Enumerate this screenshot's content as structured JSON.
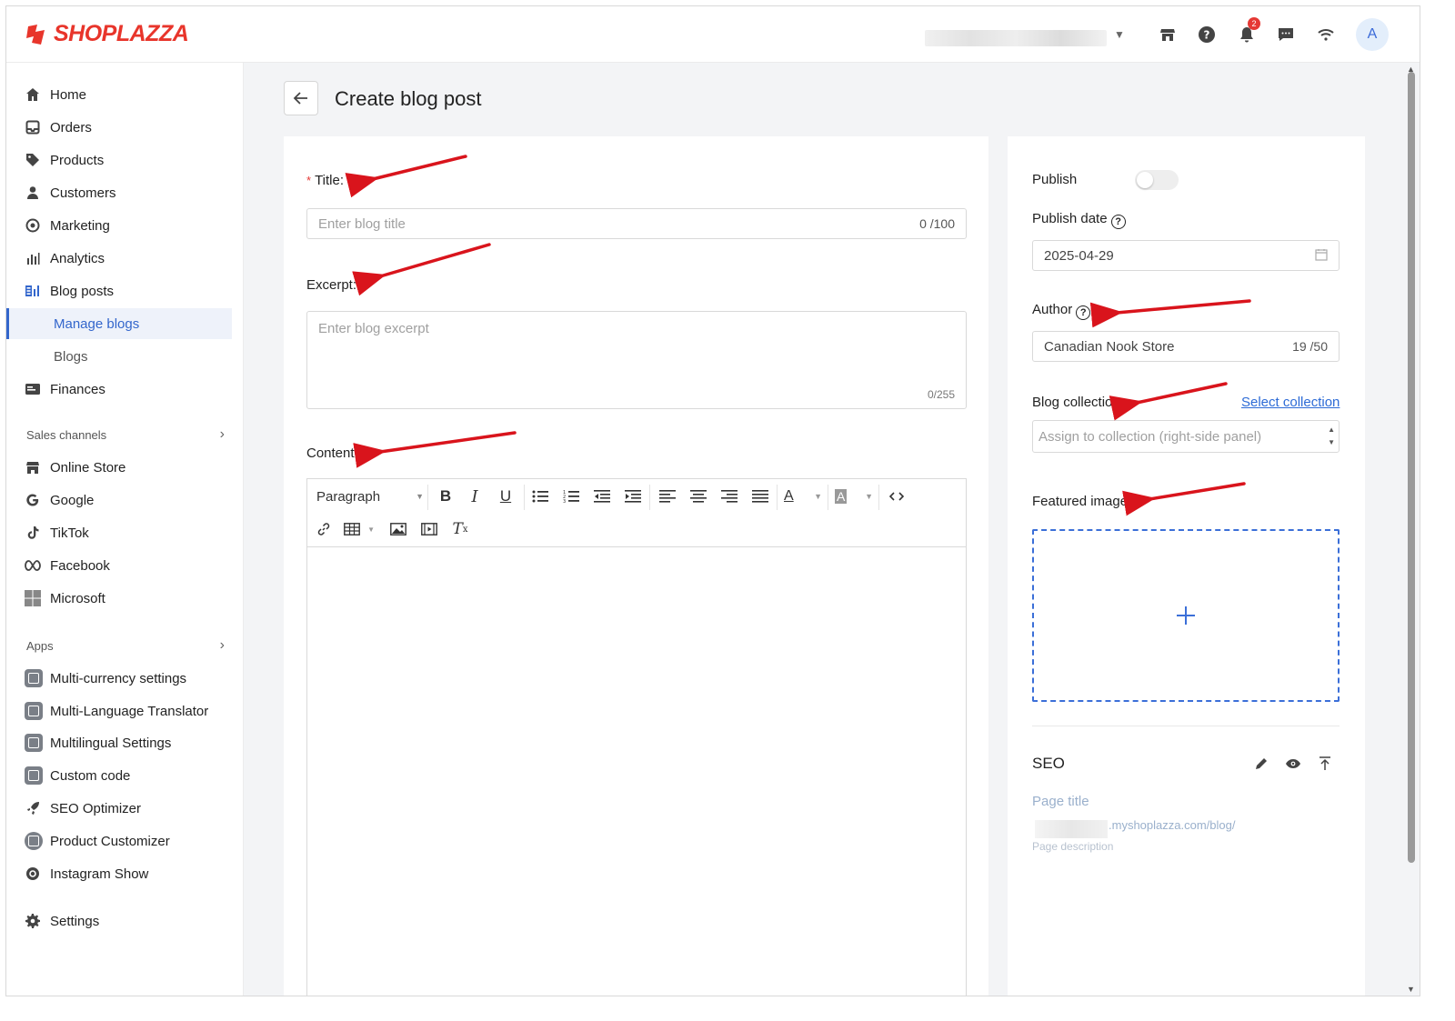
{
  "brand": {
    "name": "SHOPLAZZA",
    "color": "#e8352b",
    "accent": "#3366cc"
  },
  "topbar": {
    "notification_count": "2",
    "avatar_initial": "A",
    "icons": [
      "store-icon",
      "help-circle-icon",
      "bell-icon",
      "chat-icon",
      "wifi-icon"
    ]
  },
  "sidebar": {
    "items": [
      {
        "label": "Home",
        "icon": "home-icon"
      },
      {
        "label": "Orders",
        "icon": "inbox-icon"
      },
      {
        "label": "Products",
        "icon": "tag-icon"
      },
      {
        "label": "Customers",
        "icon": "person-icon"
      },
      {
        "label": "Marketing",
        "icon": "target-icon"
      },
      {
        "label": "Analytics",
        "icon": "bar-chart-icon"
      },
      {
        "label": "Blog posts",
        "icon": "blog-icon"
      }
    ],
    "blog_sub": [
      {
        "label": "Manage blogs",
        "active": true
      },
      {
        "label": "Blogs",
        "active": false
      }
    ],
    "finances": {
      "label": "Finances",
      "icon": "wallet-icon"
    },
    "sales_channels": {
      "heading": "Sales channels",
      "items": [
        {
          "label": "Online Store",
          "icon": "store-icon"
        },
        {
          "label": "Google",
          "icon": "google-icon"
        },
        {
          "label": "TikTok",
          "icon": "tiktok-icon"
        },
        {
          "label": "Facebook",
          "icon": "meta-icon"
        },
        {
          "label": "Microsoft",
          "icon": "microsoft-icon"
        }
      ]
    },
    "apps": {
      "heading": "Apps",
      "items": [
        {
          "label": "Multi-currency settings"
        },
        {
          "label": "Multi-Language Translator"
        },
        {
          "label": "Multilingual Settings"
        },
        {
          "label": "Custom code"
        },
        {
          "label": "SEO Optimizer"
        },
        {
          "label": "Product Customizer"
        },
        {
          "label": "Instagram Show"
        }
      ]
    },
    "settings": {
      "label": "Settings",
      "icon": "gear-icon"
    }
  },
  "page": {
    "title": "Create blog post"
  },
  "form": {
    "title_label": "Title",
    "title_colon": ":",
    "title_placeholder": "Enter blog title",
    "title_counter": "0 /100",
    "excerpt_label": "Excerpt",
    "excerpt_colon": ":",
    "excerpt_placeholder": "Enter blog excerpt",
    "excerpt_counter": "0/255",
    "content_label": "Content",
    "content_colon": ":",
    "editor": {
      "block_format": "Paragraph"
    }
  },
  "side": {
    "publish_label": "Publish",
    "publish_on": false,
    "publish_date_label": "Publish date",
    "publish_date_value": "2025-04-29",
    "author_label": "Author",
    "author_value": "Canadian Nook Store",
    "author_counter": "19 /50",
    "collection_label": "Blog collection",
    "collection_link": "Select collection",
    "collection_placeholder": "Assign to collection (right-side panel)",
    "featured_label": "Featured image",
    "seo": {
      "title": "SEO",
      "page_title": "Page title",
      "url_suffix": ".myshoplazza.com/blog/",
      "page_description": "Page description"
    }
  }
}
